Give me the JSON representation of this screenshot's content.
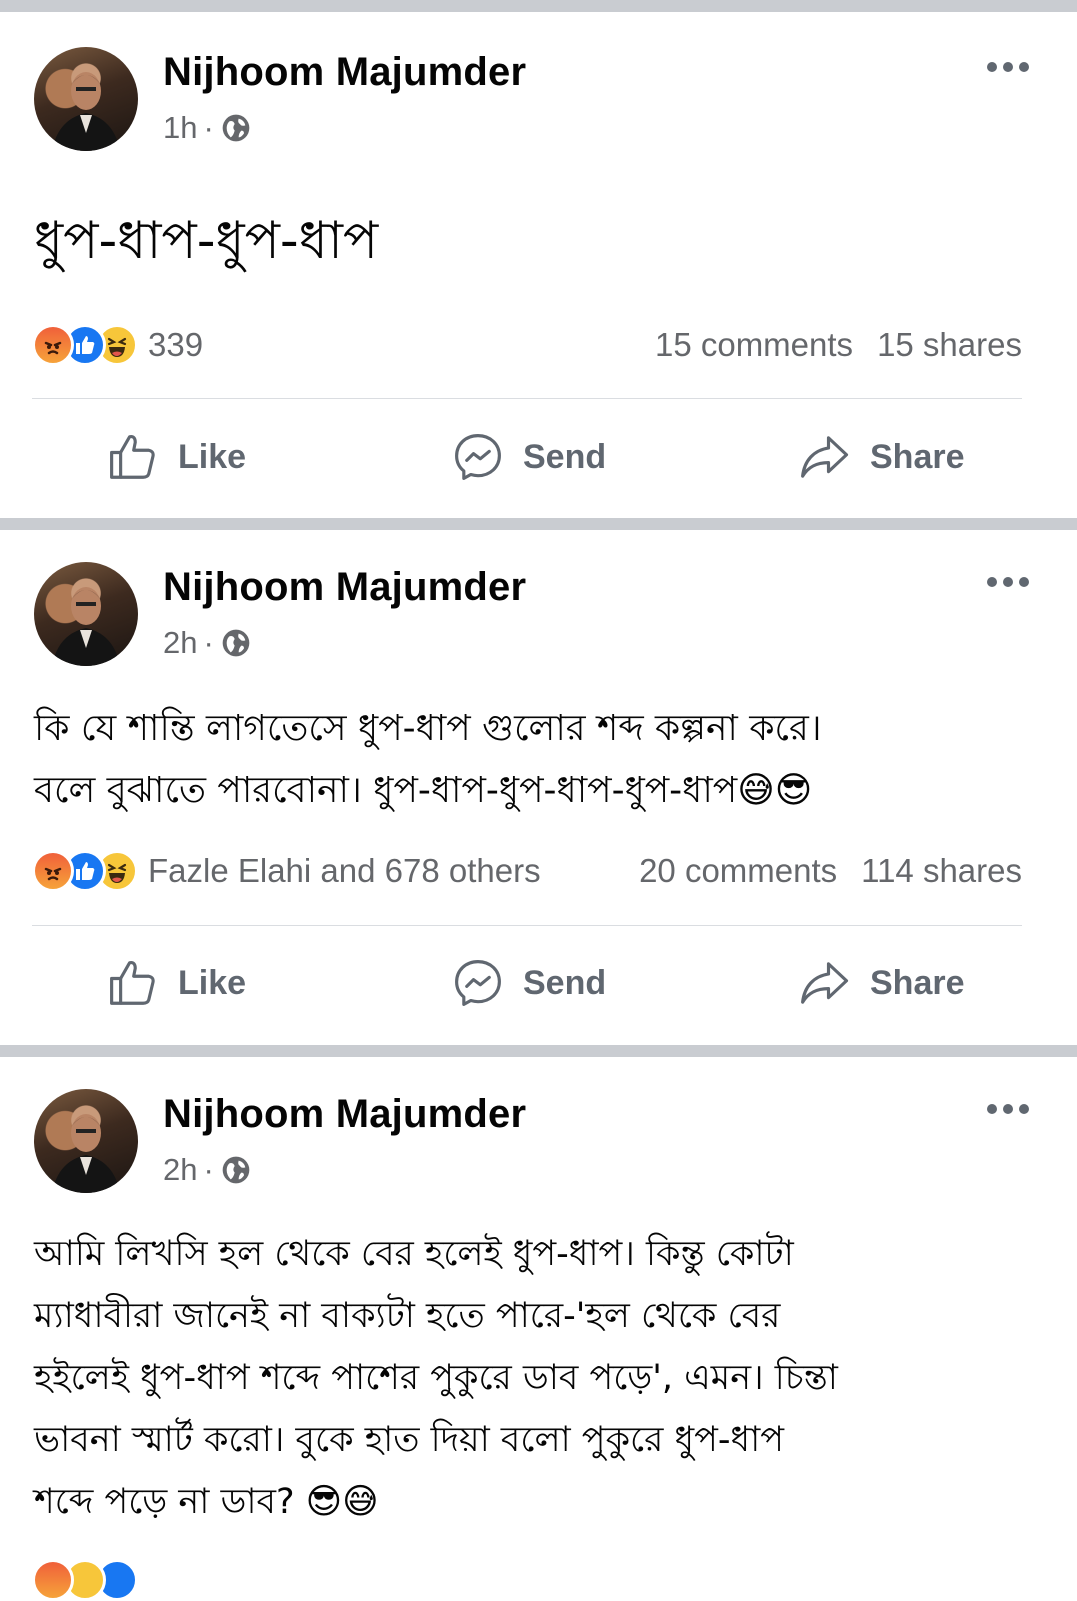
{
  "posts": [
    {
      "author": "Nijhoom Majumder",
      "time": "1h",
      "separator": "·",
      "audience_icon": "globe-icon",
      "text_lines": [
        "ধুপ-ধাপ-ধুপ-ধাপ"
      ],
      "reactions_summary": "339",
      "comments": "15 comments",
      "shares": "15 shares",
      "actions": {
        "like": "Like",
        "send": "Send",
        "share": "Share"
      }
    },
    {
      "author": "Nijhoom Majumder",
      "time": "2h",
      "separator": "·",
      "audience_icon": "globe-icon",
      "text_lines": [
        "কি যে শান্তি লাগতেসে ধুপ-ধাপ গুলোর শব্দ কল্পনা করে।",
        "বলে বুঝাতে পারবোনা। ধুপ-ধাপ-ধুপ-ধাপ-ধুপ-ধাপ😅😎"
      ],
      "reactions_summary": "Fazle Elahi and 678 others",
      "comments": "20 comments",
      "shares": "114 shares",
      "actions": {
        "like": "Like",
        "send": "Send",
        "share": "Share"
      }
    },
    {
      "author": "Nijhoom Majumder",
      "time": "2h",
      "separator": "·",
      "audience_icon": "globe-icon",
      "text_lines": [
        "আমি লিখসি হল থেকে বের হলেই ধুপ-ধাপ। কিন্তু কোটা",
        "ম্যাধাবীরা জানেই না বাক্যটা হতে পারে-'হল থেকে বের",
        "হইলেই ধুপ-ধাপ শব্দে পাশের পুকুরে ডাব পড়ে', এমন। চিন্তা",
        "ভাবনা স্মার্ট করো। বুকে হাত দিয়া বলো পুকুরে ধুপ-ধাপ",
        "শব্দে পড়ে না ডাব? 😎😅"
      ]
    }
  ],
  "colors": {
    "like_blue": "#1877f2",
    "secondary_text": "#65676b",
    "divider": "#c9ccd1"
  }
}
